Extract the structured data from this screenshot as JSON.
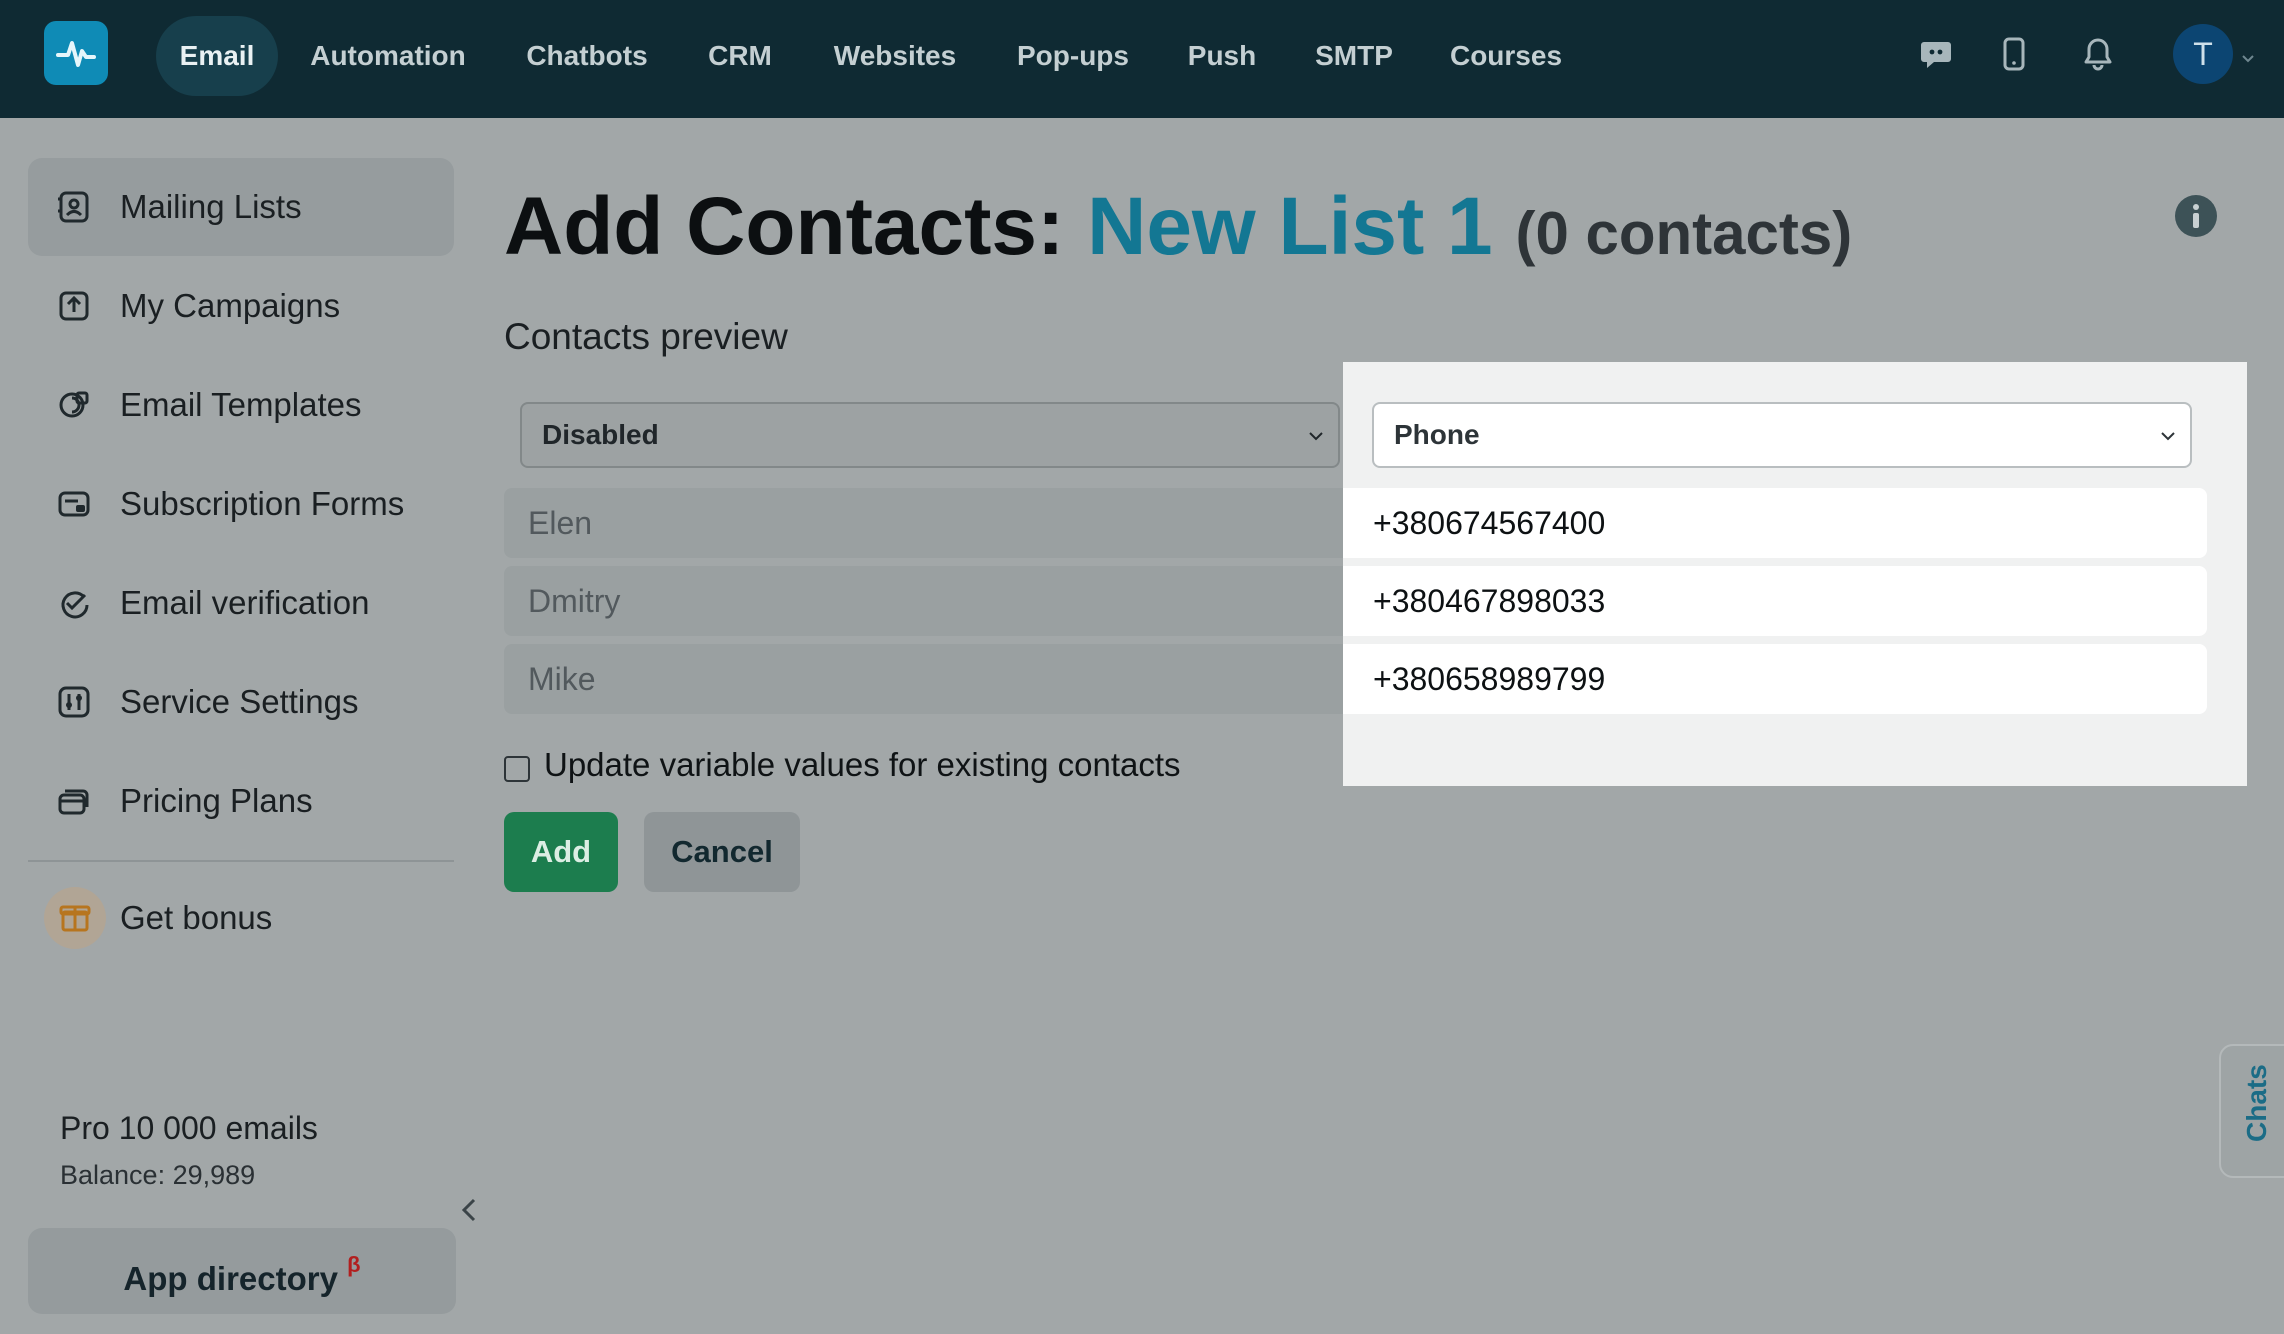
{
  "topnav": {
    "items": [
      "Email",
      "Automation",
      "Chatbots",
      "CRM",
      "Websites",
      "Pop-ups",
      "Push",
      "SMTP",
      "Courses"
    ],
    "active": "Email",
    "avatar_initial": "T"
  },
  "sidebar": {
    "items": [
      {
        "label": "Mailing Lists",
        "icon": "contact-book-icon",
        "active": true
      },
      {
        "label": "My Campaigns",
        "icon": "upload-icon",
        "active": false
      },
      {
        "label": "Email Templates",
        "icon": "template-icon",
        "active": false
      },
      {
        "label": "Subscription Forms",
        "icon": "form-icon",
        "active": false
      },
      {
        "label": "Email verification",
        "icon": "check-circle-icon",
        "active": false
      },
      {
        "label": "Service Settings",
        "icon": "sliders-icon",
        "active": false
      },
      {
        "label": "Pricing Plans",
        "icon": "cards-icon",
        "active": false
      }
    ],
    "bonus_label": "Get bonus",
    "plan": {
      "name": "Pro 10 000 emails",
      "balance": "Balance: 29,989"
    },
    "app_directory": {
      "label": "App directory",
      "badge": "β"
    }
  },
  "main": {
    "title_prefix": "Add Contacts:",
    "list_name": "New List 1",
    "contact_count": "(0 contacts)",
    "preview_label": "Contacts preview",
    "columns": [
      {
        "mapping": "Disabled",
        "values": [
          "Elen",
          "Dmitry",
          "Mike"
        ]
      },
      {
        "mapping": "Phone",
        "values": [
          "+380674567400",
          "+380467898033",
          "+380658989799"
        ]
      }
    ],
    "update_checkbox_label": "Update variable values for existing contacts",
    "update_checkbox_checked": false,
    "add_button": "Add",
    "cancel_button": "Cancel"
  },
  "chats_tab": "Chats",
  "colors": {
    "topbar": "#0f2a33",
    "accent_blue": "#137793",
    "add_green": "#1c7d4e",
    "overlay_gray": "#a2a7a8"
  }
}
